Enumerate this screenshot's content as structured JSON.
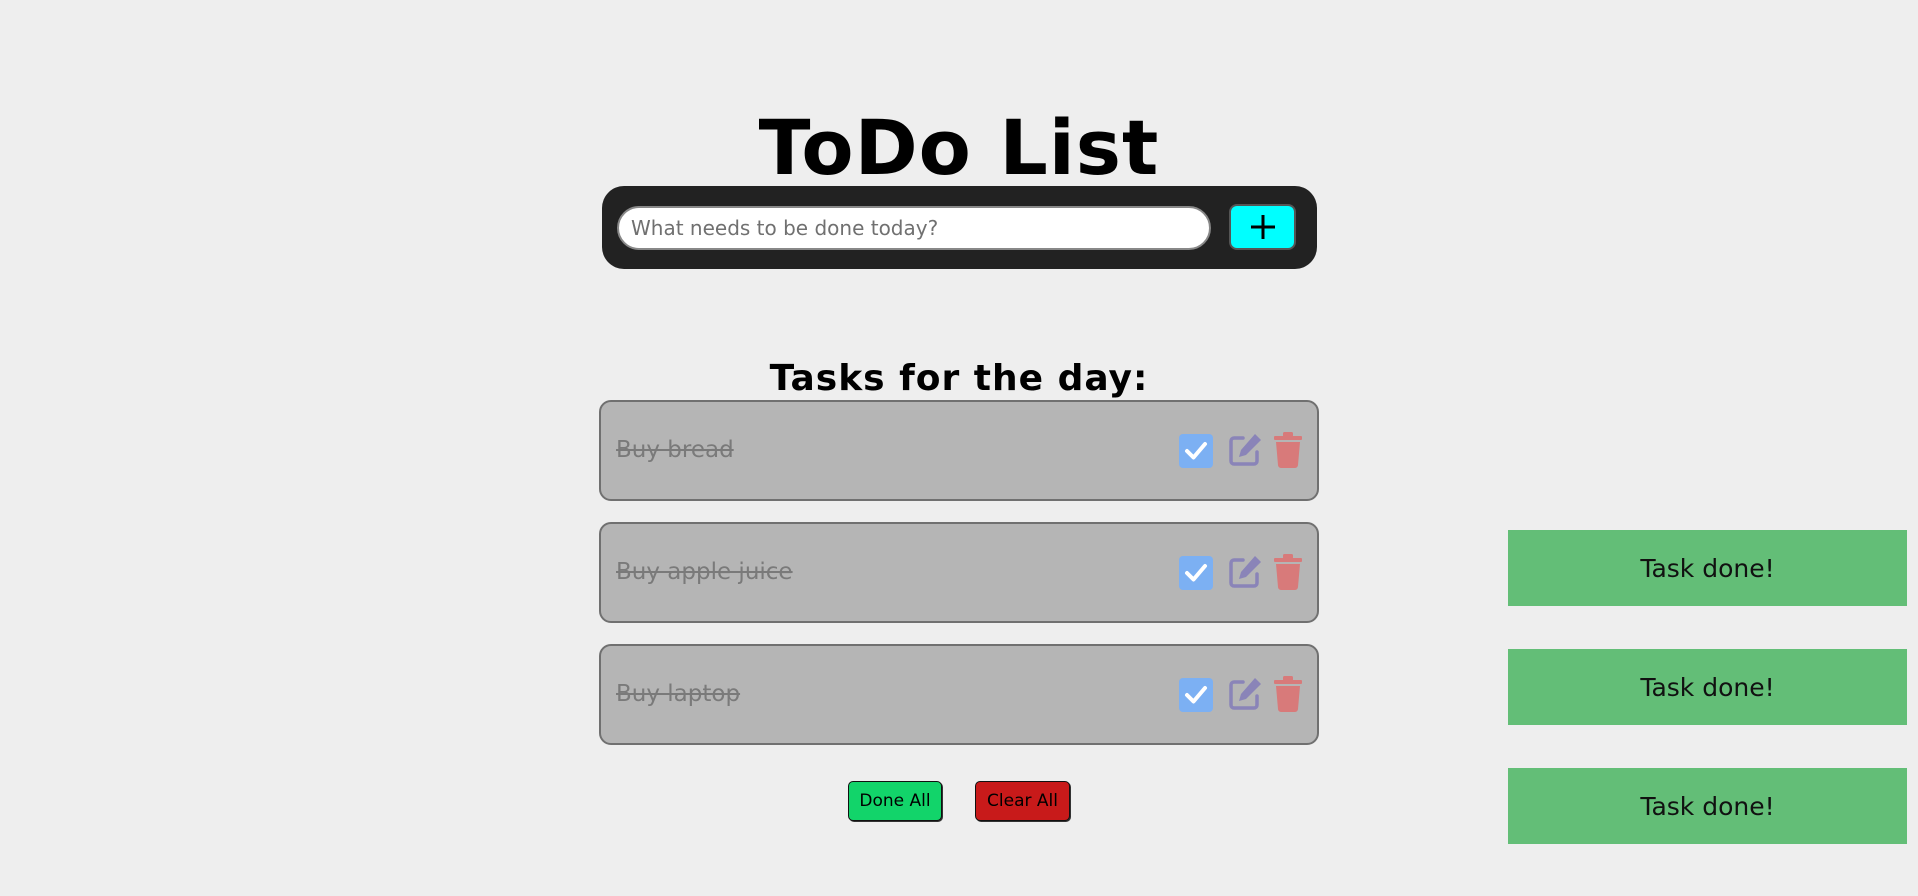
{
  "header": {
    "title": "ToDo List"
  },
  "add_form": {
    "placeholder": "What needs to be done today?",
    "value": "",
    "add_icon": "plus-icon"
  },
  "task_list": {
    "heading": "Tasks for the day:",
    "tasks": [
      {
        "text": "Buy bread",
        "done": true
      },
      {
        "text": "Buy apple juice",
        "done": true
      },
      {
        "text": "Buy laptop",
        "done": true
      }
    ],
    "icons": [
      "checkbox-icon",
      "edit-icon",
      "trash-icon"
    ]
  },
  "actions": {
    "done_all_label": "Done All",
    "clear_all_label": "Clear All"
  },
  "toasts": [
    {
      "message": "Task done!"
    },
    {
      "message": "Task done!"
    },
    {
      "message": "Task done!"
    }
  ],
  "colors": {
    "background": "#eeeeee",
    "add_bar": "#222222",
    "add_button": "#00ffff",
    "task_card": "#b5b5b5",
    "checkbox": "#7cb0f3",
    "edit_icon": "#8a84b8",
    "trash_icon": "#d87a7a",
    "done_all": "#12d46a",
    "clear_all": "#c81a1a",
    "toast": "#63be77"
  }
}
